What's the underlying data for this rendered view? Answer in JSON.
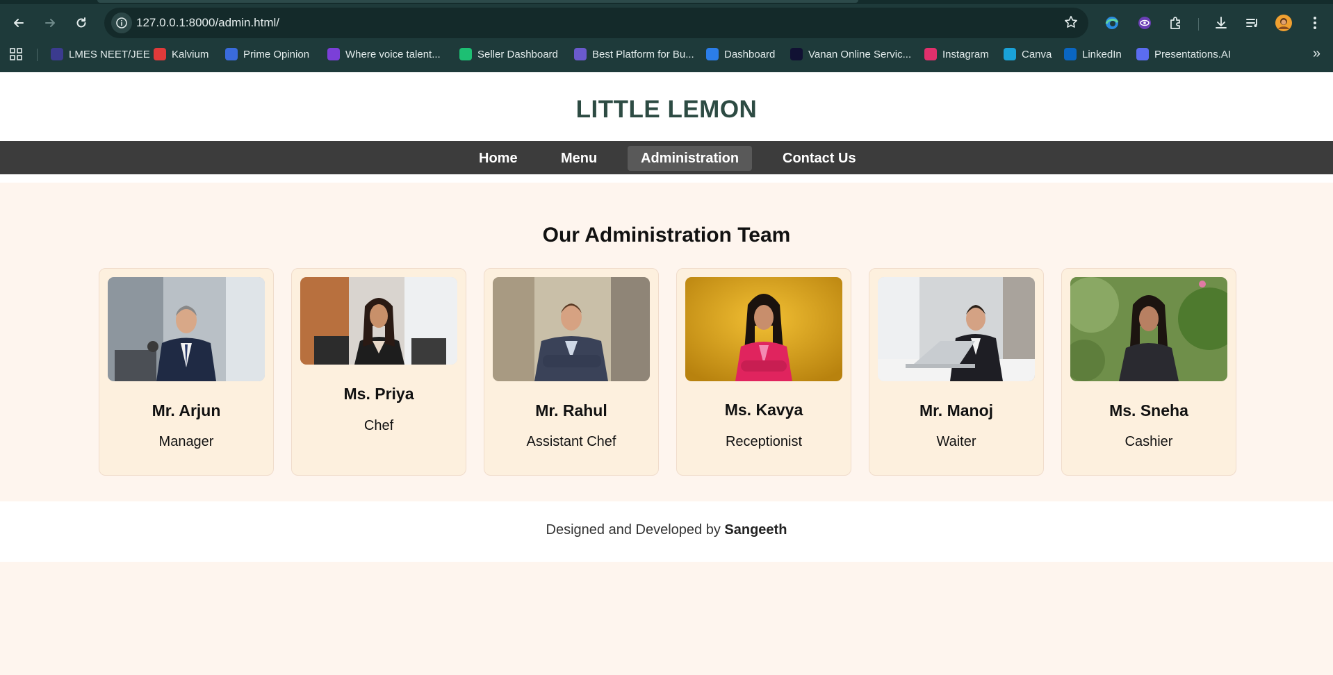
{
  "browser": {
    "url": "127.0.0.1:8000/admin.html/",
    "bookmarks": [
      {
        "label": "LMES NEET/JEE",
        "icon": "lmes-icon",
        "color": "#3b3b8f"
      },
      {
        "label": "Kalvium",
        "icon": "kalvium-icon",
        "color": "#e03a3a"
      },
      {
        "label": "Prime Opinion",
        "icon": "prime-opinion-icon",
        "color": "#3a6bdc"
      },
      {
        "label": "Where voice talent...",
        "icon": "voice-icon",
        "color": "#7b3fd8"
      },
      {
        "label": "Seller Dashboard",
        "icon": "fiverr-icon",
        "color": "#1dbf73"
      },
      {
        "label": "Best Platform for Bu...",
        "icon": "platform-icon",
        "color": "#6a5acd"
      },
      {
        "label": "Dashboard",
        "icon": "dashboard-icon",
        "color": "#2b7de9"
      },
      {
        "label": "Vanan Online Servic...",
        "icon": "vanan-icon",
        "color": "#111133"
      },
      {
        "label": "Instagram",
        "icon": "instagram-icon",
        "color": "#e1306c"
      },
      {
        "label": "Canva",
        "icon": "canva-icon",
        "color": "#1aa2d8"
      },
      {
        "label": "LinkedIn",
        "icon": "linkedin-icon",
        "color": "#0a66c2"
      },
      {
        "label": "Presentations.AI",
        "icon": "presentations-ai-icon",
        "color": "#5b6cf0"
      }
    ]
  },
  "site": {
    "title": "LITTLE LEMON",
    "nav": [
      {
        "label": "Home",
        "active": false
      },
      {
        "label": "Menu",
        "active": false
      },
      {
        "label": "Administration",
        "active": true
      },
      {
        "label": "Contact Us",
        "active": false
      }
    ]
  },
  "team": {
    "heading": "Our Administration Team",
    "members": [
      {
        "name": "Mr. Arjun",
        "role": "Manager",
        "photo": "man-in-office-photo"
      },
      {
        "name": "Ms. Priya",
        "role": "Chef",
        "photo": "woman-in-office-photo"
      },
      {
        "name": "Mr. Rahul",
        "role": "Assistant Chef",
        "photo": "man-arms-crossed-photo"
      },
      {
        "name": "Ms. Kavya",
        "role": "Receptionist",
        "photo": "woman-yellow-background-photo"
      },
      {
        "name": "Mr. Manoj",
        "role": "Waiter",
        "photo": "man-at-laptop-photo"
      },
      {
        "name": "Ms. Sneha",
        "role": "Cashier",
        "photo": "woman-outdoors-photo"
      }
    ]
  },
  "footer": {
    "prefix": "Designed and Developed by",
    "author": "Sangeeth"
  }
}
